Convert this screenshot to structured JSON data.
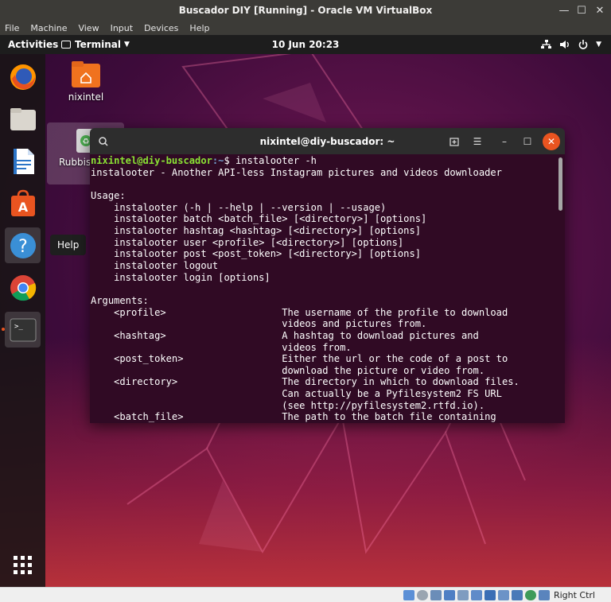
{
  "host": {
    "window_title": "Buscador DIY [Running] - Oracle VM VirtualBox",
    "menu": [
      "File",
      "Machine",
      "View",
      "Input",
      "Devices",
      "Help"
    ],
    "host_key": "Right Ctrl"
  },
  "topbar": {
    "activities": "Activities",
    "app_menu": "Terminal",
    "clock": "10 Jun  20:23"
  },
  "desktop": {
    "home_label": "nixintel",
    "trash_label": "Rubbish"
  },
  "dock": {
    "tooltip": "Help",
    "items": [
      "firefox-icon",
      "files-icon",
      "writer-icon",
      "software-icon",
      "help-icon",
      "chrome-icon",
      "terminal-icon"
    ]
  },
  "terminal": {
    "title": "nixintel@diy-buscador: ~",
    "prompt_user": "nixintel@diy-buscador",
    "prompt_path": ":~",
    "prompt_symbol": "$ ",
    "command": "instalooter -h",
    "output": "instalooter - Another API-less Instagram pictures and videos downloader\n\nUsage:\n    instalooter (-h | --help | --version | --usage)\n    instalooter batch <batch_file> [<directory>] [options]\n    instalooter hashtag <hashtag> [<directory>] [options]\n    instalooter user <profile> [<directory>] [options]\n    instalooter post <post_token> [<directory>] [options]\n    instalooter logout\n    instalooter login [options]\n\nArguments:\n    <profile>                    The username of the profile to download\n                                 videos and pictures from.\n    <hashtag>                    A hashtag to download pictures and\n                                 videos from.\n    <post_token>                 Either the url or the code of a post to\n                                 download the picture or video from.\n    <directory>                  The directory in which to download files.\n                                 Can actually be a Pyfilesystem2 FS URL\n                                 (see http://pyfilesystem2.rtfd.io).\n    <batch_file>                 The path to the batch file containing"
  }
}
